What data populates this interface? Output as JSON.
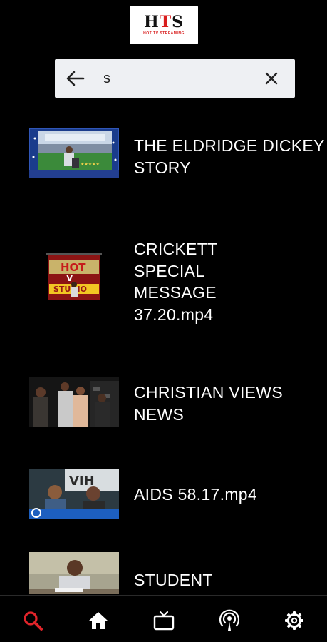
{
  "app": {
    "logo_text": "HTS",
    "logo_subtext": "HOT TV STREAMING"
  },
  "search": {
    "value": "s",
    "placeholder": "",
    "back_icon": "arrow-left-icon",
    "clear_icon": "close-icon"
  },
  "results": [
    {
      "title": "THE ELDRIDGE DICKEY STORY",
      "thumb": "stadium-podium-thumbnail"
    },
    {
      "title": "CRICKETT SPECIAL MESSAGE 37.20.mp4",
      "thumb": "hot-tv-studio-thumbnail"
    },
    {
      "title": "CHRISTIAN VIEWS NEWS",
      "thumb": "red-carpet-people-thumbnail"
    },
    {
      "title": "AIDS 58.17.mp4",
      "thumb": "news-anchors-thumbnail"
    },
    {
      "title": "STUDENT",
      "thumb": "man-at-desk-thumbnail"
    }
  ],
  "bottom_nav": {
    "items": [
      {
        "name": "search",
        "icon": "search-icon",
        "active": true
      },
      {
        "name": "home",
        "icon": "home-icon",
        "active": false
      },
      {
        "name": "tv",
        "icon": "tv-icon",
        "active": false
      },
      {
        "name": "podcast",
        "icon": "podcast-icon",
        "active": false
      },
      {
        "name": "settings",
        "icon": "gear-icon",
        "active": false
      }
    ],
    "active_color": "#e0242a",
    "inactive_color": "#ffffff"
  }
}
